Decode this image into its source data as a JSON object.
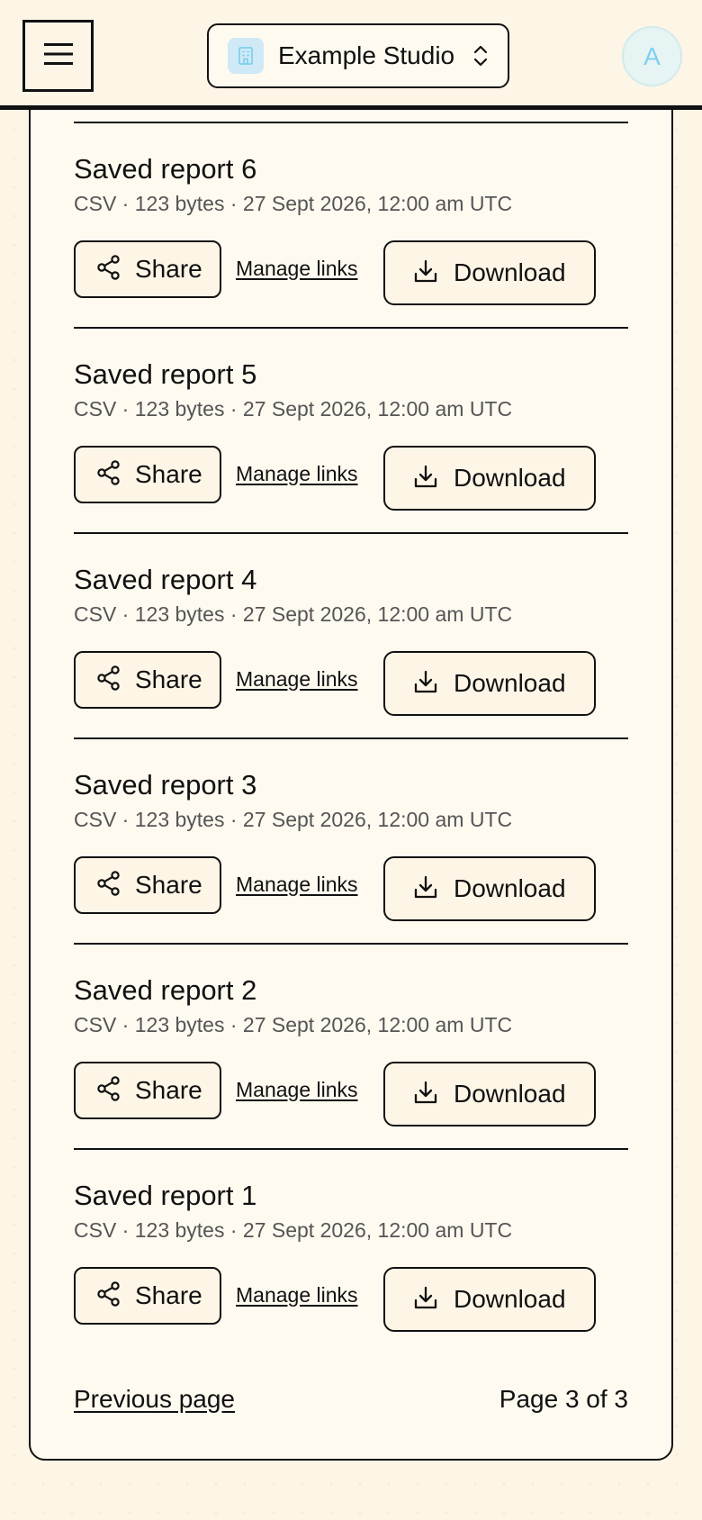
{
  "header": {
    "org_name": "Example Studio",
    "avatar_initial": "A",
    "accent_color": "#7fd0ee"
  },
  "reports": [
    {
      "title": "Saved report 6",
      "meta": "CSV · 123 bytes · 27 Sept 2026, 12:00 am UTC",
      "share_label": "Share",
      "manage_label": "Manage links",
      "download_label": "Download"
    },
    {
      "title": "Saved report 5",
      "meta": "CSV · 123 bytes · 27 Sept 2026, 12:00 am UTC",
      "share_label": "Share",
      "manage_label": "Manage links",
      "download_label": "Download"
    },
    {
      "title": "Saved report 4",
      "meta": "CSV · 123 bytes · 27 Sept 2026, 12:00 am UTC",
      "share_label": "Share",
      "manage_label": "Manage links",
      "download_label": "Download"
    },
    {
      "title": "Saved report 3",
      "meta": "CSV · 123 bytes · 27 Sept 2026, 12:00 am UTC",
      "share_label": "Share",
      "manage_label": "Manage links",
      "download_label": "Download"
    },
    {
      "title": "Saved report 2",
      "meta": "CSV · 123 bytes · 27 Sept 2026, 12:00 am UTC",
      "share_label": "Share",
      "manage_label": "Manage links",
      "download_label": "Download"
    },
    {
      "title": "Saved report 1",
      "meta": "CSV · 123 bytes · 27 Sept 2026, 12:00 am UTC",
      "share_label": "Share",
      "manage_label": "Manage links",
      "download_label": "Download"
    }
  ],
  "pagination": {
    "prev_label": "Previous page",
    "status": "Page 3 of 3"
  }
}
